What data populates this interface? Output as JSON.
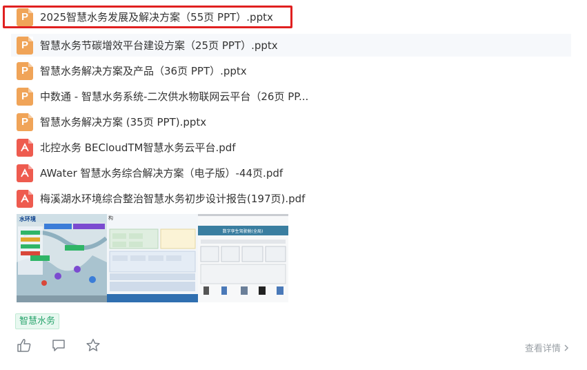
{
  "files": [
    {
      "name": "2025智慧水务发展及解决方案（55页 PPT）.pptx",
      "type": "ppt",
      "icon_letter": "P"
    },
    {
      "name": "智慧水务节碳增效平台建设方案（25页 PPT）.pptx",
      "type": "ppt",
      "icon_letter": "P"
    },
    {
      "name": "智慧水务解决方案及产品（36页 PPT）.pptx",
      "type": "ppt",
      "icon_letter": "P"
    },
    {
      "name": "中数通 - 智慧水务系统-二次供水物联网云平台（26页 PP...",
      "type": "ppt",
      "icon_letter": "P"
    },
    {
      "name": "智慧水务解决方案 (35页 PPT).pptx",
      "type": "ppt",
      "icon_letter": "P"
    },
    {
      "name": "北控水务 BECloudTM智慧水务云平台.pdf",
      "type": "pdf"
    },
    {
      "name": "AWater 智慧水务综合解决方案（电子版）-44页.pdf",
      "type": "pdf"
    },
    {
      "name": "梅溪湖水环境综合整治智慧水务初步设计报告(197页).pdf",
      "type": "pdf"
    }
  ],
  "thumbnails": {
    "t1_title": "水环境",
    "t2_title": "构",
    "t3_title": "数字孪生驾驶舱(全局)"
  },
  "tag": "智慧水务",
  "detail_label": "查看详情",
  "icons": {
    "like": "thumbs-up-icon",
    "comment": "comment-icon",
    "favorite": "star-icon",
    "detail": "chevron-right-icon"
  },
  "colors": {
    "ppt_icon": "#f0a458",
    "pdf_icon": "#ee5b4f",
    "selection_border": "#e02020",
    "tag_text": "#28a46c"
  }
}
